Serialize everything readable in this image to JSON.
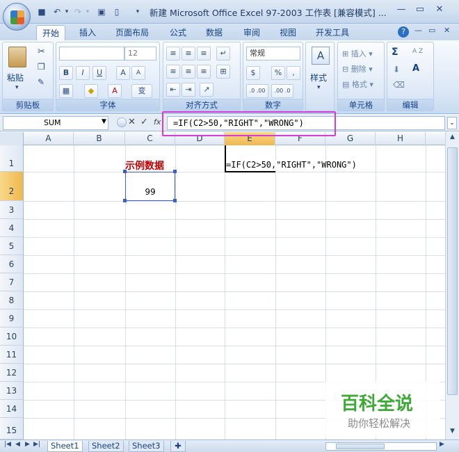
{
  "window": {
    "title": "新建 Microsoft Office Excel 97-2003 工作表 [兼容模式] ..."
  },
  "quick_access": {
    "save_icon": "save-icon",
    "undo_icon": "undo-icon",
    "redo_icon": "redo-icon"
  },
  "tabs": [
    "开始",
    "插入",
    "页面布局",
    "公式",
    "数据",
    "审阅",
    "视图",
    "开发工具"
  ],
  "ribbon": {
    "clipboard": {
      "label": "剪贴板",
      "paste": "粘贴"
    },
    "font": {
      "label": "字体",
      "size": "12",
      "bold": "B",
      "italic": "I",
      "underline": "U",
      "grow": "A",
      "shrink": "A",
      "color": "A",
      "phonetic": "变"
    },
    "alignment": {
      "label": "对齐方式"
    },
    "number": {
      "label": "数字",
      "format": "常规",
      "percent": "%",
      "comma": ",",
      "inc_dec": ".0 .00",
      "dec_dec": ".00 .0"
    },
    "styles": {
      "label": "样式"
    },
    "cells": {
      "label": "单元格",
      "insert": "插入",
      "delete": "删除",
      "format": "格式"
    },
    "editing": {
      "label": "编辑",
      "sum": "Σ",
      "sort": "A Z",
      "find": "A"
    }
  },
  "formula_bar": {
    "name_box": "SUM",
    "cancel": "✕",
    "enter": "✓",
    "fx": "fx",
    "formula": "=IF(C2>50,\"RIGHT\",\"WRONG\")"
  },
  "columns": [
    "A",
    "B",
    "C",
    "D",
    "E",
    "F",
    "G",
    "H"
  ],
  "rows": [
    "1",
    "2",
    "3",
    "4",
    "5",
    "6",
    "7",
    "8",
    "9",
    "10",
    "11",
    "12",
    "13",
    "14",
    "15"
  ],
  "cells": {
    "C1": "示例数据",
    "C2": "99",
    "E1": "=IF(C2>50,\"RIGHT\",\"WRONG\")"
  },
  "sheets": [
    "Sheet1",
    "Sheet2",
    "Sheet3"
  ],
  "watermark": {
    "main": "百科全说",
    "sub": "助你轻松解决"
  },
  "colors": {
    "accent": "#15428b",
    "header_selected": "#f0b84e",
    "highlight_box": "#d53bd6",
    "red_text": "#c00000",
    "watermark_green": "#3daa36"
  }
}
